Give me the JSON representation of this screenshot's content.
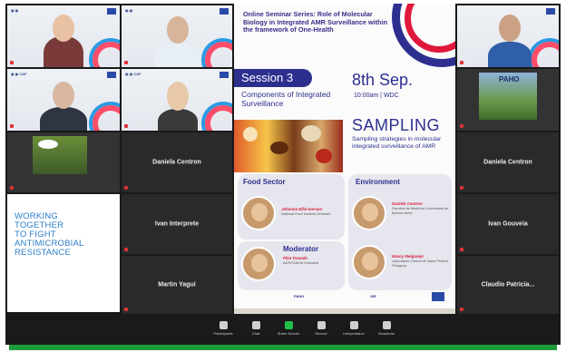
{
  "slide": {
    "title": "Online Seminar Series: Role of Molecular Biology in Integrated AMR Surveillance within the framework of One-Health",
    "session": "Session 3",
    "components": "Components of Integrated Surveillance",
    "date": "8th Sep.",
    "time": "10:00am | WDC",
    "sampling": "SAMPLING",
    "sampling_sub": "Sampling strategies in molecular integrated surveillance of AMR",
    "food_sector": "Food Sector",
    "environment": "Environment",
    "moderator": "Moderator",
    "speakers": [
      {
        "name": "Johanne Ellis-Iversen",
        "inst": "National Food Institute Denmark"
      },
      {
        "name": "Daniela Centron",
        "inst": "Facultad de Medicina Universidad de Buenos Aires"
      },
      {
        "name": "Pilar Donado",
        "inst": "AGROSAVIA Colombia"
      },
      {
        "name": "Nancy Melgarejo",
        "inst": "Laboratorio Central de Salud Pública, Paraguay"
      }
    ],
    "logos": {
      "paho": "PAHO",
      "oie": "OIE"
    }
  },
  "participants": {
    "daniela": "Daniela Centron",
    "ivan_interprete": "Ivan Interprete",
    "martin": "Martin Yagui",
    "daniela_right": "Daniela Centron",
    "ivan_gouveia": "Ivan Gouveia",
    "claudio": "Claudio Patricia..."
  },
  "paho_tile_label": "PAHO",
  "banner": {
    "line1": "WORKING",
    "line2": "TOGETHER",
    "line3": "TO FIGHT",
    "line4": "ANTIMICROBIAL",
    "line5": "RESISTANCE"
  },
  "toolbar": {
    "participants": "Participants",
    "chat": "Chat",
    "share_screen": "Share Screen",
    "record": "Record",
    "interpretation": "Interpretation",
    "reactions": "Reactions"
  },
  "colors": {
    "accent": "#2d2f8f",
    "red": "#e0183c",
    "green": "#1f9a3c",
    "banner_text": "#2b7cc8"
  }
}
